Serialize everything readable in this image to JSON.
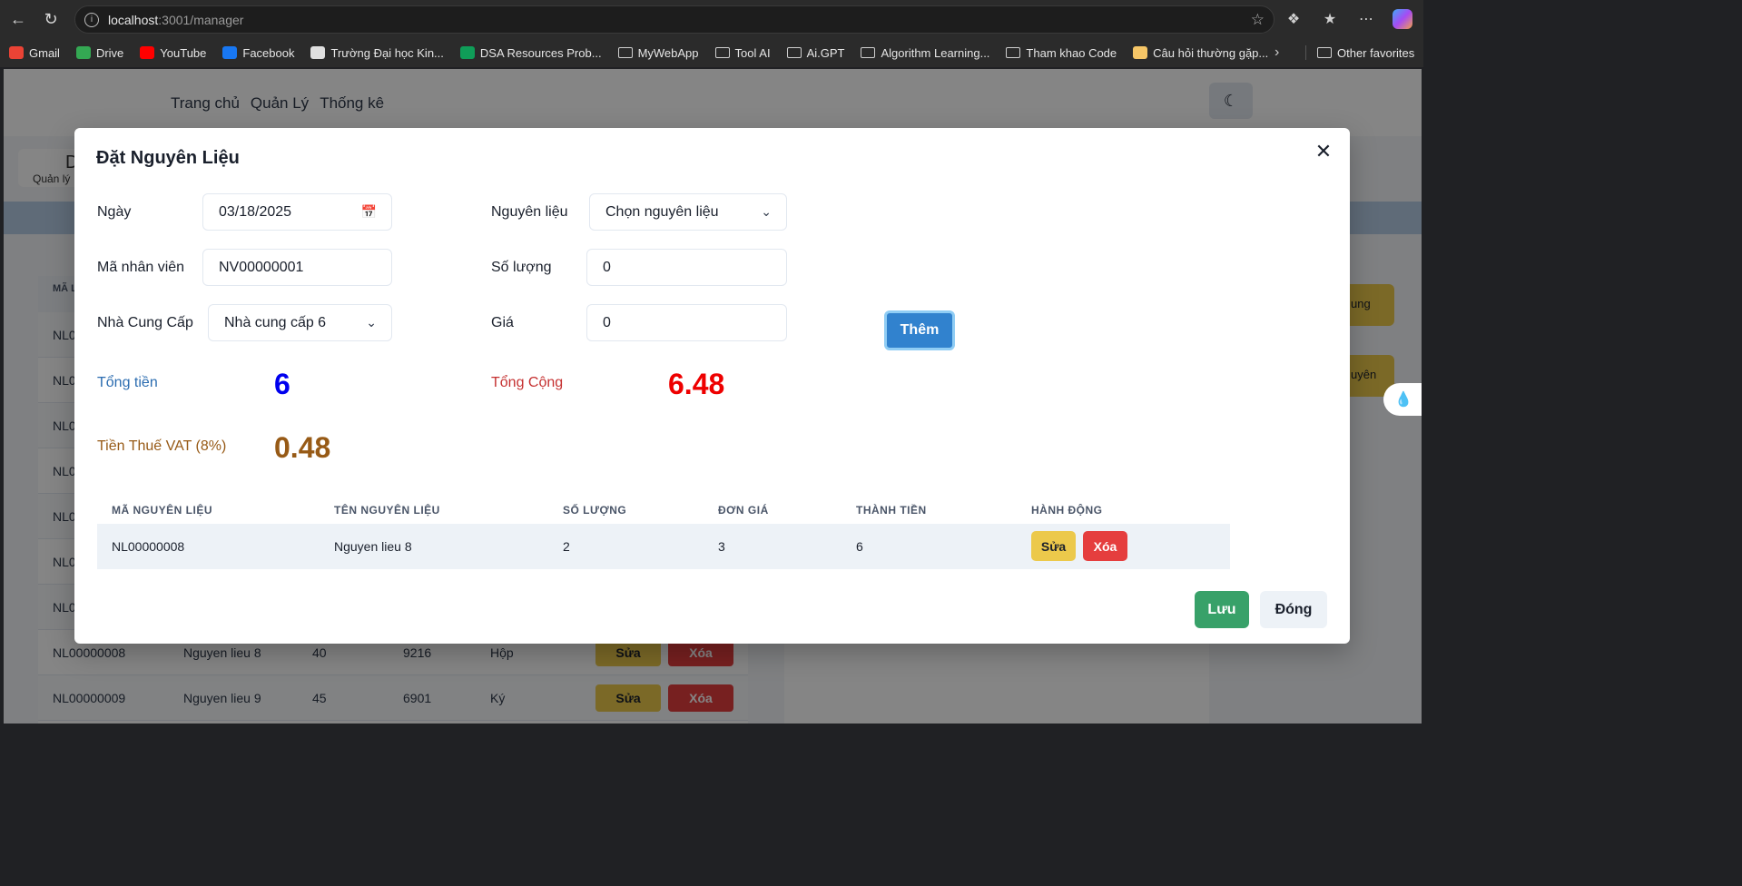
{
  "browser": {
    "url_host": "localhost",
    "url_rest": ":3001/manager",
    "bookmarks": [
      {
        "label": "Gmail",
        "icon": "gmail-icon",
        "color": "#ea4335"
      },
      {
        "label": "Drive",
        "icon": "drive-icon",
        "color": "#34a853"
      },
      {
        "label": "YouTube",
        "icon": "youtube-icon",
        "color": "#ff0000"
      },
      {
        "label": "Facebook",
        "icon": "facebook-icon",
        "color": "#1877f2"
      },
      {
        "label": "Trường Đại học Kin...",
        "icon": "shield-icon",
        "color": "#e0e0e0"
      },
      {
        "label": "DSA Resources Prob...",
        "icon": "sheets-icon",
        "color": "#0f9d58"
      },
      {
        "label": "MyWebApp",
        "icon": "folder-icon",
        "color": "#cfcfcf"
      },
      {
        "label": "Tool AI",
        "icon": "folder-icon",
        "color": "#cfcfcf"
      },
      {
        "label": "Ai.GPT",
        "icon": "folder-icon",
        "color": "#cfcfcf"
      },
      {
        "label": "Algorithm Learning...",
        "icon": "folder-icon",
        "color": "#cfcfcf"
      },
      {
        "label": "Tham khao Code",
        "icon": "folder-icon",
        "color": "#cfcfcf"
      },
      {
        "label": "Câu hỏi thường gặp...",
        "icon": "emoji-icon",
        "color": "#f6c667"
      }
    ],
    "other_favorites": "Other favorites"
  },
  "app": {
    "nav": [
      "Trang chủ",
      "Quản Lý",
      "Thống kê"
    ],
    "side_card_label": "Quản lý",
    "side_card_glyph": "D",
    "bg_header": "MÃ LIỆU",
    "bg_rows_partial": [
      "NL0",
      "NL0",
      "NL0",
      "NL0",
      "NL0",
      "NL0",
      "NL0"
    ],
    "bg_rows": [
      {
        "code": "NL00000008",
        "name": "Nguyen lieu 8",
        "qty": "40",
        "price": "9216",
        "unit": "Hộp"
      },
      {
        "code": "NL00000009",
        "name": "Nguyen lieu 9",
        "qty": "45",
        "price": "6901",
        "unit": "Ký"
      }
    ],
    "bg_sua": "Sửa",
    "bg_xoa": "Xóa",
    "bg_yellow_1": "ung",
    "bg_yellow_2": "uyên"
  },
  "modal": {
    "title": "Đặt Nguyên Liệu",
    "date_label": "Ngày",
    "date_value": "03/18/2025",
    "employee_label": "Mã nhân viên",
    "employee_value": "NV00000001",
    "supplier_label": "Nhà Cung Cấp",
    "supplier_value": "Nhà cung cấp 6",
    "ingredient_label": "Nguyên liệu",
    "ingredient_value": "Chọn nguyên liệu",
    "qty_label": "Số lượng",
    "qty_value": "0",
    "price_label": "Giá",
    "price_value": "0",
    "add_button": "Thêm",
    "subtotal_label": "Tổng tiền",
    "subtotal_value": "6",
    "total_label": "Tổng Cộng",
    "total_value": "6.48",
    "vat_label": "Tiền Thuế VAT (8%)",
    "vat_value": "0.48",
    "columns": [
      "MÃ NGUYÊN LIỆU",
      "TÊN NGUYÊN LIỆU",
      "SỐ LƯỢNG",
      "ĐƠN GIÁ",
      "THÀNH TIỀN",
      "HÀNH ĐỘNG"
    ],
    "rows": [
      {
        "code": "NL00000008",
        "name": "Nguyen lieu 8",
        "qty": "2",
        "price": "3",
        "amount": "6"
      }
    ],
    "edit_label": "Sửa",
    "delete_label": "Xóa",
    "save_button": "Lưu",
    "close_button": "Đóng"
  },
  "colors": {
    "subtotal": "#0000ee",
    "total": "#ee0000",
    "vat": "#975a16",
    "save": "#38a169",
    "add": "#3182ce"
  }
}
